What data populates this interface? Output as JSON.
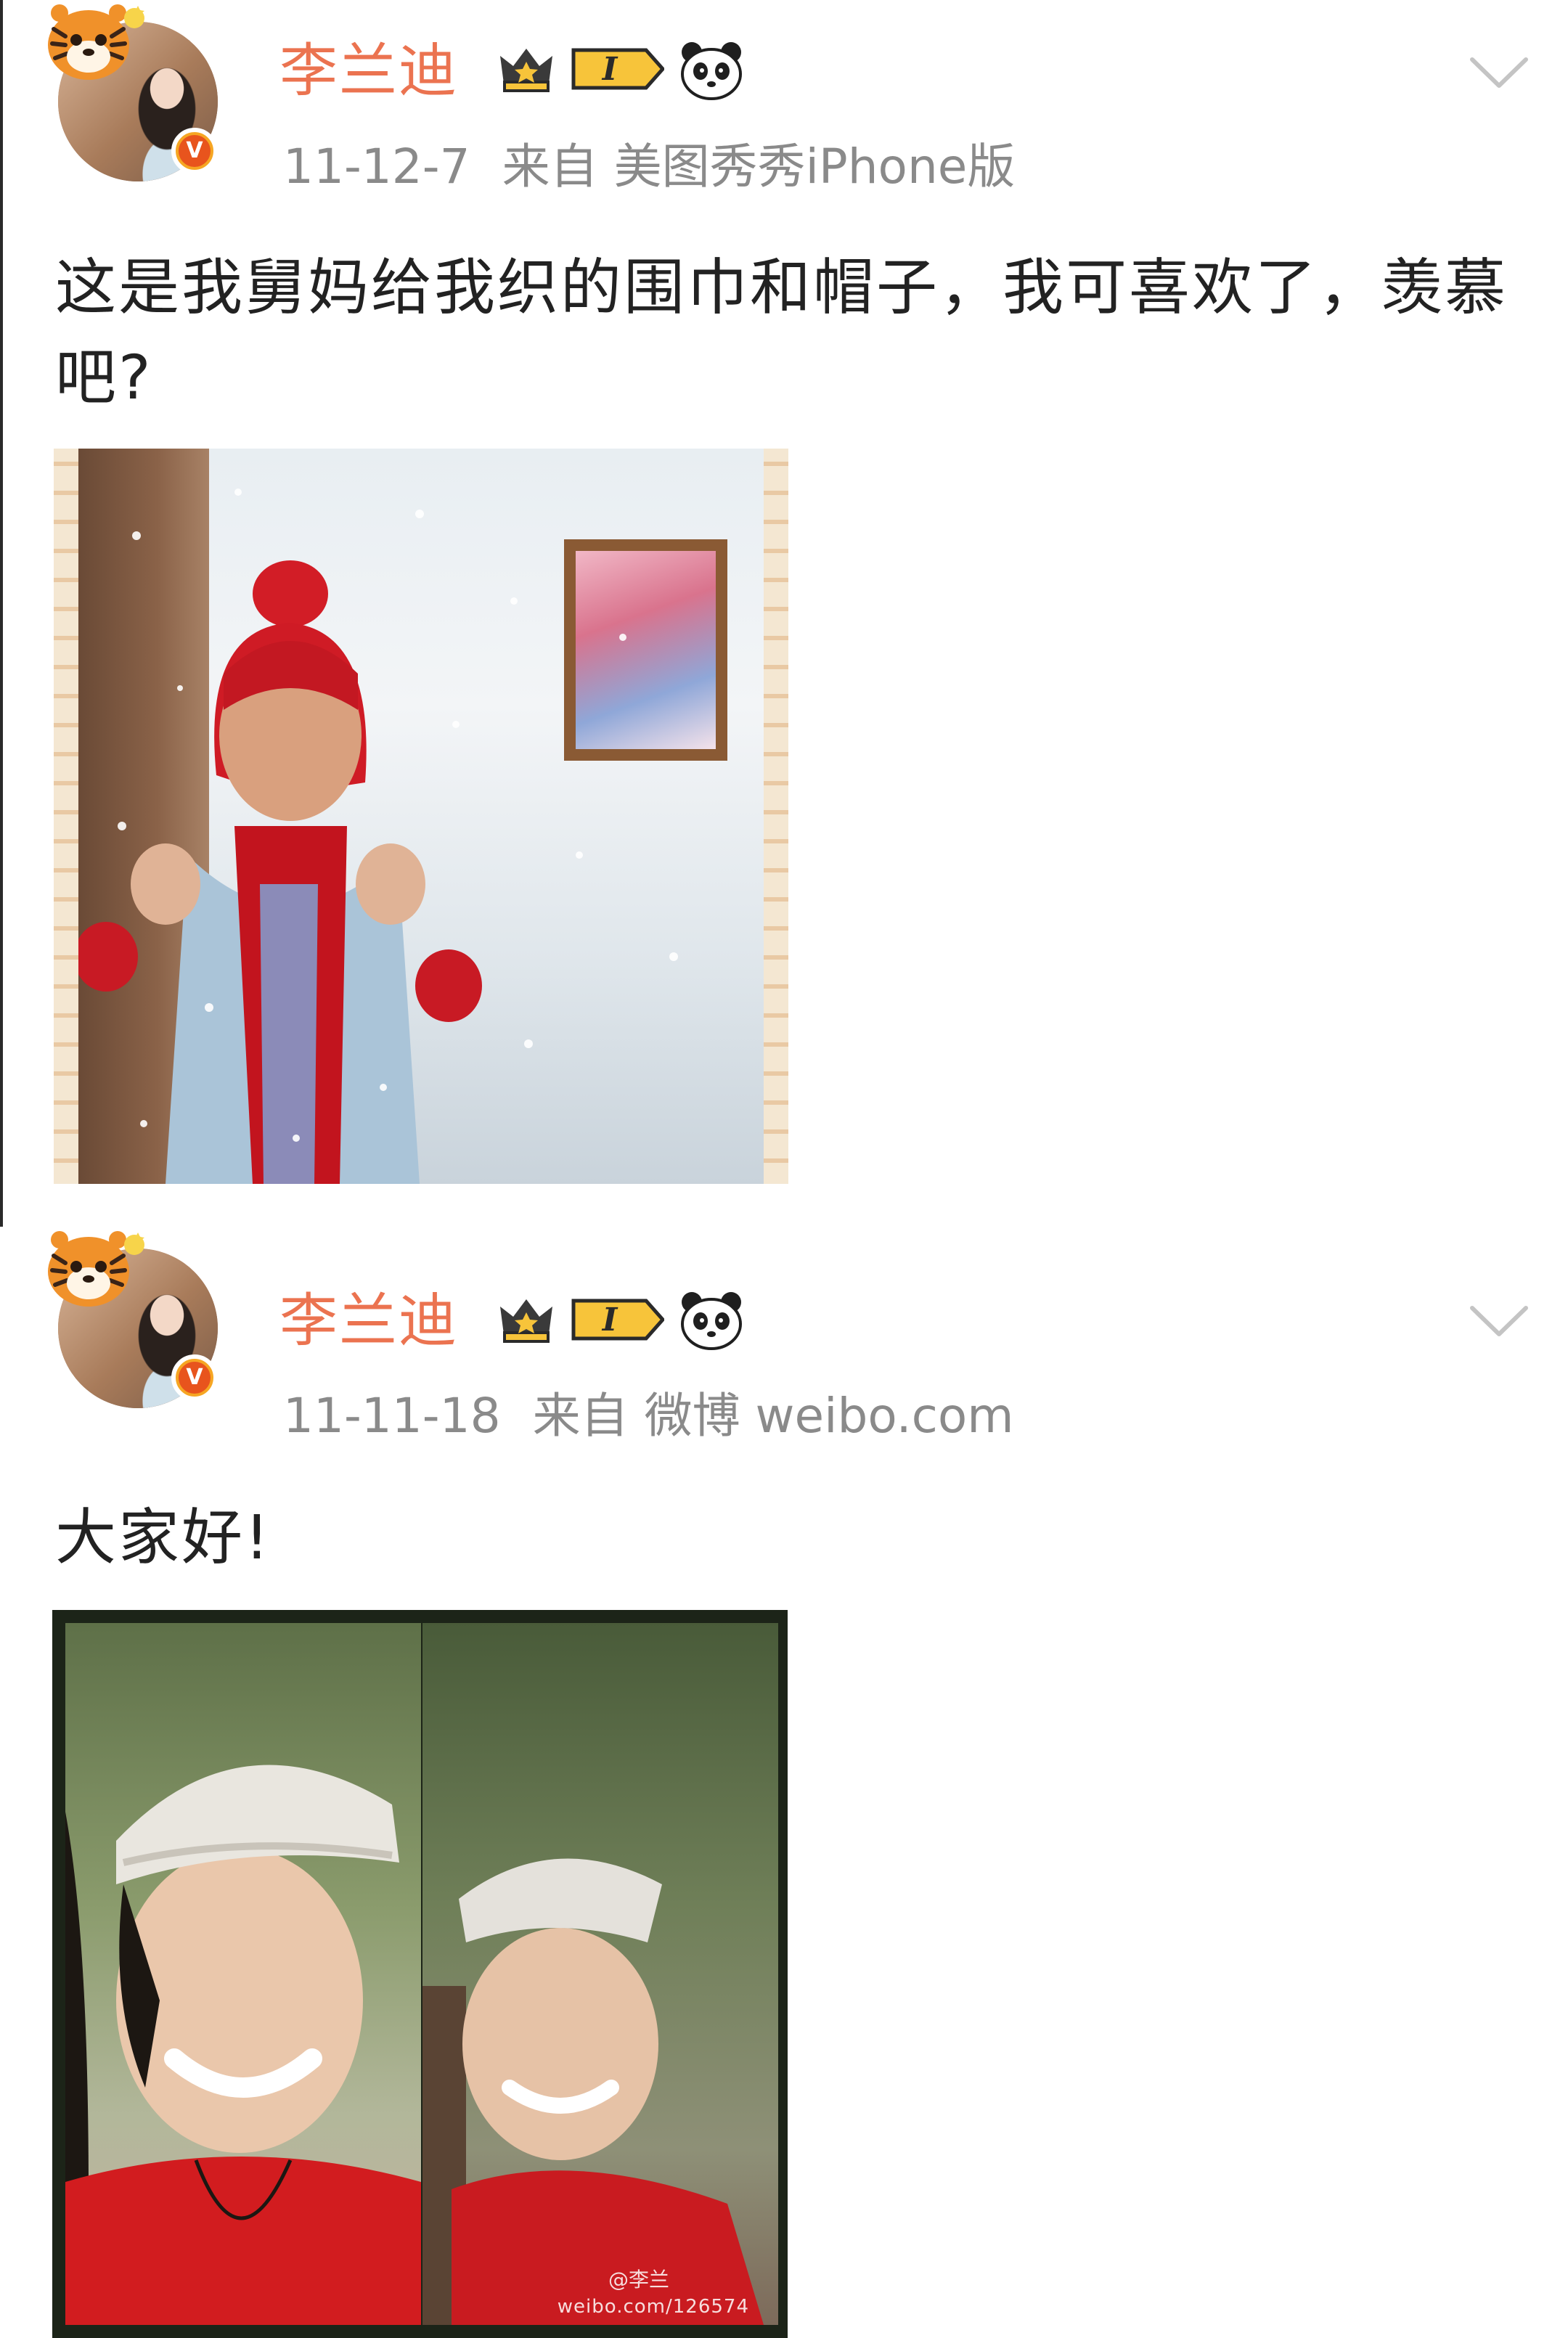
{
  "posts": [
    {
      "username": "李兰迪",
      "member_level": "I",
      "date": "11-12-7",
      "via": "来自",
      "source": "美图秀秀iPhone版",
      "text": "这是我舅妈给我织的围巾和帽子，我可喜欢了，羡慕吧?",
      "verified": "V"
    },
    {
      "username": "李兰迪",
      "member_level": "I",
      "date": "11-11-18",
      "via": "来自",
      "source": "微博 weibo.com",
      "text": "大家好!",
      "verified": "V",
      "photo_watermark": "weibo.com/126574",
      "photo_watermark_handle": "@李兰"
    }
  ],
  "colors": {
    "username": "#eb7350",
    "meta": "#8a8a8a",
    "text": "#222222",
    "verified_outer": "#f6a623",
    "verified_inner": "#e8541d"
  },
  "icons": {
    "expand": "chevron-down-icon",
    "member": "crown-member-badge-icon",
    "emoji": "panda-icon",
    "verified": "verified-v-badge"
  }
}
